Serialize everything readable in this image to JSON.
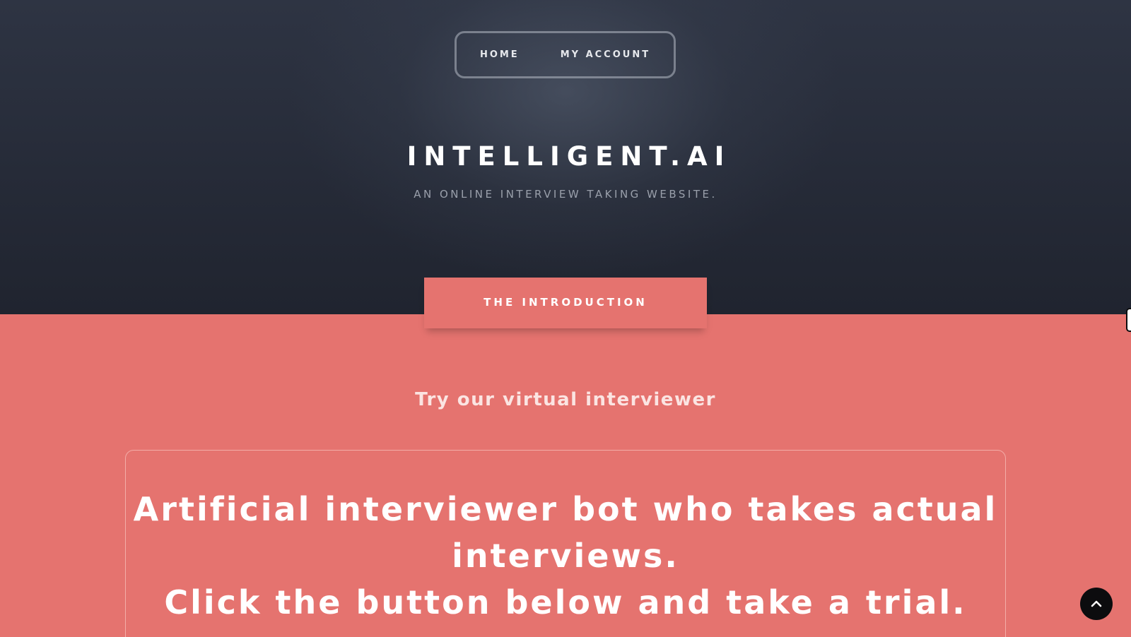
{
  "nav": {
    "home_label": "HOME",
    "account_label": "MY ACCOUNT"
  },
  "header": {
    "title": "INTELLIGENT.AI",
    "subtitle": "AN ONLINE INTERVIEW TAKING WEBSITE."
  },
  "intro": {
    "tab_label": "THE INTRODUCTION",
    "tagline": "Try our virtual interviewer",
    "card_line1": "Artificial interviewer bot who takes actual",
    "card_line2": "interviews.",
    "card_line3": "Click the button below and take a trial."
  },
  "icons": {
    "scroll_top": "chevron-up-icon"
  },
  "colors": {
    "header_bg": "#262b38",
    "accent_coral": "#e5736f",
    "scroll_button": "#0c0c0e"
  }
}
